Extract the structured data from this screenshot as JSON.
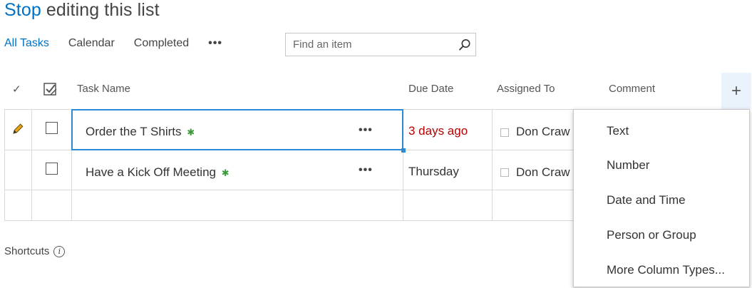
{
  "header": {
    "title_action": "Stop",
    "title_rest": " editing this list"
  },
  "views": {
    "items": [
      "All Tasks",
      "Calendar",
      "Completed"
    ],
    "more": "•••"
  },
  "search": {
    "placeholder": "Find an item"
  },
  "columns": {
    "check": "✓",
    "task_name": "Task Name",
    "due_date": "Due Date",
    "assigned_to": "Assigned To",
    "comment": "Comment",
    "add": "+"
  },
  "rows": [
    {
      "task": "Order the T Shirts",
      "new_marker": "✱",
      "actions": "•••",
      "due": "3 days ago",
      "assigned": "Don Craw"
    },
    {
      "task": "Have a Kick Off Meeting",
      "new_marker": "✱",
      "actions": "•••",
      "due": "Thursday",
      "assigned": "Don Craw"
    }
  ],
  "column_type_menu": [
    "Text",
    "Number",
    "Date and Time",
    "Person or Group",
    "More Column Types..."
  ],
  "footer": {
    "shortcuts": "Shortcuts",
    "info": "i"
  },
  "colors": {
    "accent": "#0072c6",
    "late": "#b40000",
    "new_marker": "#3a9a3a",
    "edit_border": "#2f8ad6"
  }
}
